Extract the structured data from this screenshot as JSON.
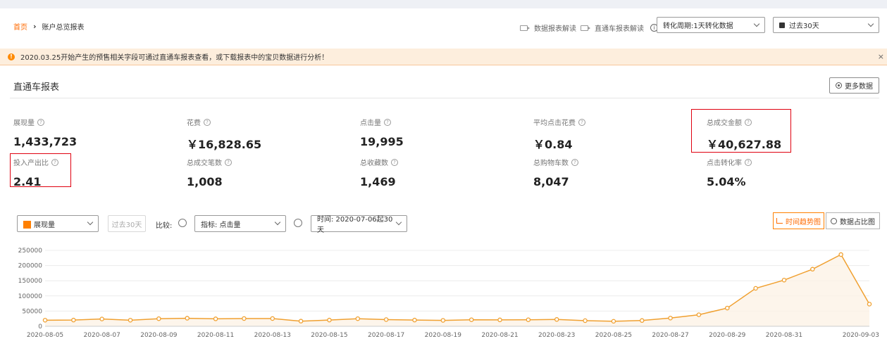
{
  "breadcrumb": {
    "home": "首页",
    "separator": "›",
    "current": "账户总览报表"
  },
  "header_links": {
    "data_report": "数据报表解读",
    "ztc_report": "直通车报表解读"
  },
  "conversion_select": {
    "value": "转化周期:1天转化数据"
  },
  "date_select": {
    "value": "过去30天"
  },
  "notice": {
    "text": "2020.03.25开始产生的预售相关字段可通过直通车报表查看，或下载报表中的宝贝数据进行分析！",
    "close": "×"
  },
  "section": {
    "title": "直通车报表",
    "more_button": "更多数据"
  },
  "metrics": [
    {
      "label": "展现量",
      "value": "1,433,723"
    },
    {
      "label": "花费",
      "value": "￥16,828.65"
    },
    {
      "label": "点击量",
      "value": "19,995"
    },
    {
      "label": "平均点击花费",
      "value": "￥0.84"
    },
    {
      "label": "总成交金额",
      "value": "￥40,627.88"
    },
    {
      "label": "投入产出比",
      "value": "2.41"
    },
    {
      "label": "总成交笔数",
      "value": "1,008"
    },
    {
      "label": "总收藏数",
      "value": "1,469"
    },
    {
      "label": "总购物车数",
      "value": "8,047"
    },
    {
      "label": "点击转化率",
      "value": "5.04%"
    }
  ],
  "controls": {
    "metric_select": "展现量",
    "past30_button": "过去30天",
    "compare_label": "比较:",
    "indicator_select": "指标:  点击量",
    "time_select": "时间:  2020-07-06起30天",
    "trend_button": "时间趋势图",
    "ratio_button": "数据占比图"
  },
  "colors": {
    "accent": "#ff8000",
    "highlight": "#e0000f"
  },
  "chart_data": {
    "type": "area",
    "x": [
      "2020-08-05",
      "2020-08-06",
      "2020-08-07",
      "2020-08-08",
      "2020-08-09",
      "2020-08-10",
      "2020-08-11",
      "2020-08-12",
      "2020-08-13",
      "2020-08-14",
      "2020-08-15",
      "2020-08-16",
      "2020-08-17",
      "2020-08-18",
      "2020-08-19",
      "2020-08-20",
      "2020-08-21",
      "2020-08-22",
      "2020-08-23",
      "2020-08-24",
      "2020-08-25",
      "2020-08-26",
      "2020-08-27",
      "2020-08-28",
      "2020-08-29",
      "2020-08-30",
      "2020-08-31",
      "2020-09-01",
      "2020-09-02",
      "2020-09-03"
    ],
    "xticks": [
      "2020-08-05",
      "2020-08-07",
      "2020-08-09",
      "2020-08-11",
      "2020-08-13",
      "2020-08-15",
      "2020-08-17",
      "2020-08-19",
      "2020-08-21",
      "2020-08-23",
      "2020-08-25",
      "2020-08-27",
      "2020-08-29",
      "2020-08-31",
      "2020-09-03"
    ],
    "series": [
      {
        "values": [
          20000,
          20500,
          24000,
          20000,
          25000,
          26500,
          24500,
          25500,
          25500,
          17000,
          20500,
          25000,
          22000,
          20500,
          19500,
          21500,
          21000,
          21500,
          22500,
          18500,
          16500,
          19000,
          27000,
          38000,
          60000,
          125000,
          152000,
          188000,
          236000,
          73000
        ]
      }
    ],
    "ylim": [
      0,
      250000
    ],
    "yticks": [
      "0",
      "50000",
      "100000",
      "150000",
      "200000",
      "250000"
    ],
    "grid": true,
    "title": "",
    "xlabel": "",
    "ylabel": ""
  }
}
